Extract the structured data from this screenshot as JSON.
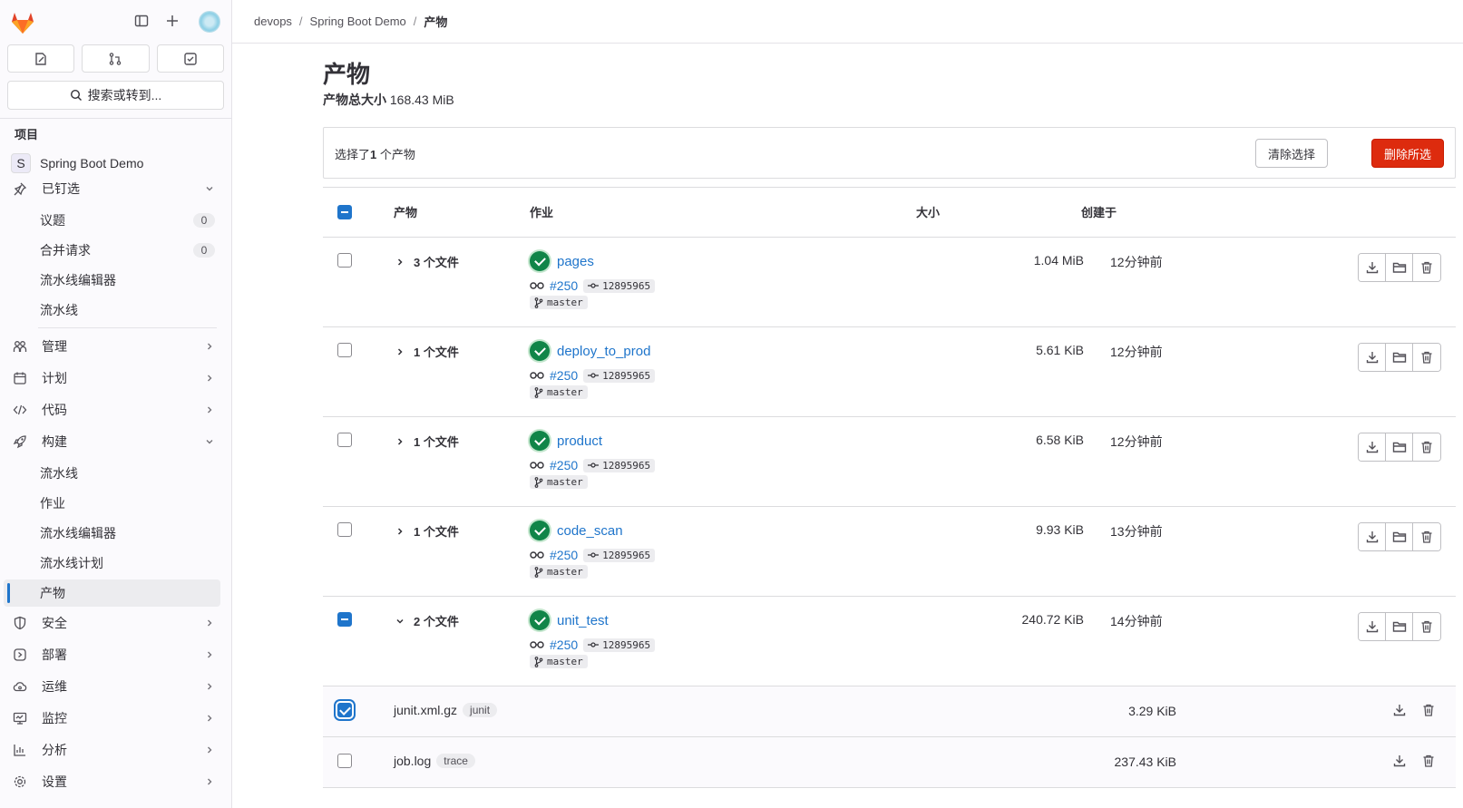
{
  "sidebar": {
    "search_label": "搜索或转到...",
    "section_title": "项目",
    "project": {
      "avatar_letter": "S",
      "name": "Spring Boot Demo"
    },
    "pinned": {
      "label": "已钉选",
      "items": [
        {
          "label": "议题",
          "count": "0"
        },
        {
          "label": "合并请求",
          "count": "0"
        },
        {
          "label": "流水线编辑器"
        },
        {
          "label": "流水线"
        }
      ]
    },
    "groups": [
      {
        "label": "管理",
        "icon": "users-icon"
      },
      {
        "label": "计划",
        "icon": "calendar-icon"
      },
      {
        "label": "代码",
        "icon": "code-icon"
      }
    ],
    "build": {
      "label": "构建",
      "items": [
        "流水线",
        "作业",
        "流水线编辑器",
        "流水线计划",
        "产物"
      ]
    },
    "more_groups": [
      {
        "label": "安全",
        "icon": "shield-icon"
      },
      {
        "label": "部署",
        "icon": "deploy-icon"
      },
      {
        "label": "运维",
        "icon": "cloud-icon"
      },
      {
        "label": "监控",
        "icon": "monitor-icon"
      },
      {
        "label": "分析",
        "icon": "chart-icon"
      },
      {
        "label": "设置",
        "icon": "settings-icon"
      }
    ]
  },
  "breadcrumb": [
    "devops",
    "Spring Boot Demo",
    "产物"
  ],
  "page": {
    "title": "产物",
    "total_label": "产物总大小",
    "total_value": "168.43 MiB"
  },
  "selection": {
    "text_prefix": "选择了",
    "count": "1",
    "text_suffix": " 个产物",
    "clear_label": "清除选择",
    "delete_label": "删除所选"
  },
  "table": {
    "headers": {
      "artifacts": "产物",
      "job": "作业",
      "size": "大小",
      "created": "创建于"
    },
    "rows": [
      {
        "files": "3 个文件",
        "job": "pages",
        "pipeline": "#250",
        "commit": "12895965",
        "branch": "master",
        "size": "1.04 MiB",
        "created": "12分钟前",
        "expanded": false
      },
      {
        "files": "1 个文件",
        "job": "deploy_to_prod",
        "pipeline": "#250",
        "commit": "12895965",
        "branch": "master",
        "size": "5.61 KiB",
        "created": "12分钟前",
        "expanded": false
      },
      {
        "files": "1 个文件",
        "job": "product",
        "pipeline": "#250",
        "commit": "12895965",
        "branch": "master",
        "size": "6.58 KiB",
        "created": "12分钟前",
        "expanded": false
      },
      {
        "files": "1 个文件",
        "job": "code_scan",
        "pipeline": "#250",
        "commit": "12895965",
        "branch": "master",
        "size": "9.93 KiB",
        "created": "13分钟前",
        "expanded": false
      },
      {
        "files": "2 个文件",
        "job": "unit_test",
        "pipeline": "#250",
        "commit": "12895965",
        "branch": "master",
        "size": "240.72 KiB",
        "created": "14分钟前",
        "expanded": true
      }
    ],
    "files": [
      {
        "name": "junit.xml.gz",
        "tag": "junit",
        "size": "3.29 KiB",
        "checked": true
      },
      {
        "name": "job.log",
        "tag": "trace",
        "size": "237.43 KiB",
        "checked": false
      }
    ]
  },
  "colors": {
    "accent": "#1f75cb",
    "danger": "#dd2b0e",
    "success": "#108548"
  }
}
